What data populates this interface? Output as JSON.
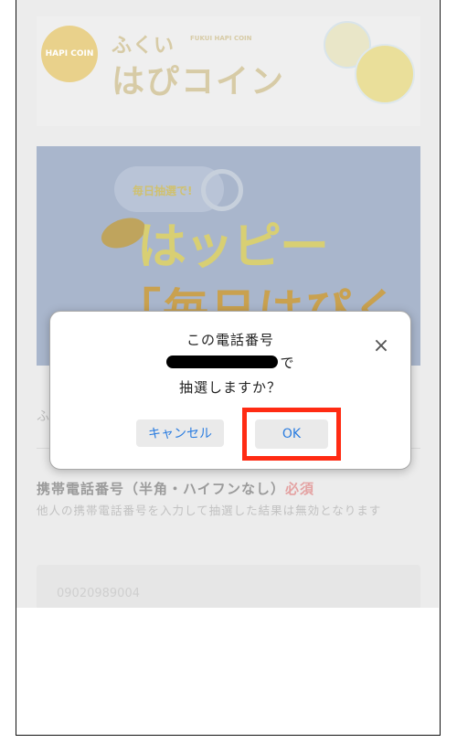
{
  "header": {
    "brand_jp_small": "ふくい",
    "brand_en": "FUKUI HAPI COIN",
    "brand_jp_big": "はぴコイン",
    "badge_text": "HAPI COIN"
  },
  "banner": {
    "cloud_text": "毎日抽選で!",
    "headline": "はッピー",
    "subline": "「毎日はぴくじ」"
  },
  "form": {
    "section_label": "ふ",
    "phone_label": "携帯電話番号（半角・ハイフンなし）",
    "required_label": "必須",
    "note": "他人の携帯電話番号を入力して抽選した結果は無効となります",
    "phone_value": "09020989004"
  },
  "dialog": {
    "line1": "この電話番号",
    "line2_suffix": "で",
    "line3": "抽選しますか？",
    "cancel_label": "キャンセル",
    "ok_label": "OK",
    "close_symbol": "×"
  },
  "colors": {
    "highlight": "#ff2b13",
    "button_text": "#2b7de0"
  }
}
